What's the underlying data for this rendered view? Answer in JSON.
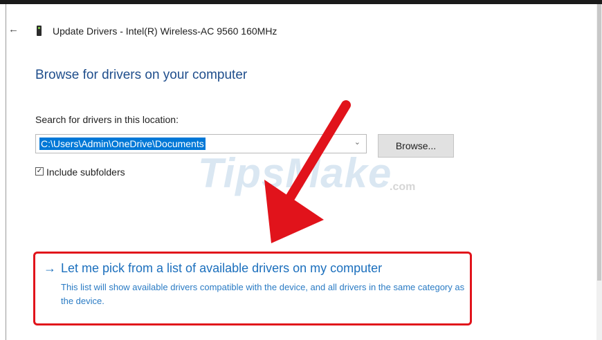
{
  "window": {
    "back_icon": "←",
    "title": "Update Drivers - Intel(R) Wireless-AC 9560 160MHz",
    "device_icon": "network-adapter-icon"
  },
  "main": {
    "heading": "Browse for drivers on your computer",
    "search_label": "Search for drivers in this location:",
    "path_value": "C:\\Users\\Admin\\OneDrive\\Documents",
    "chevron": "⌄",
    "browse_label": "Browse...",
    "checkbox_mark": "✓",
    "include_subfolders_label": "Include subfolders",
    "include_subfolders_checked": true
  },
  "watermark": {
    "text": "TipsMake",
    "suffix": ".com"
  },
  "pick_option": {
    "arrow": "→",
    "link": "Let me pick from a list of available drivers on my computer",
    "description": "This list will show available drivers compatible with the device, and all drivers in the same category as the device."
  },
  "colors": {
    "heading": "#1f4e8c",
    "link": "#1b6fbd",
    "selection": "#0078d7",
    "highlight": "#e1131b"
  }
}
